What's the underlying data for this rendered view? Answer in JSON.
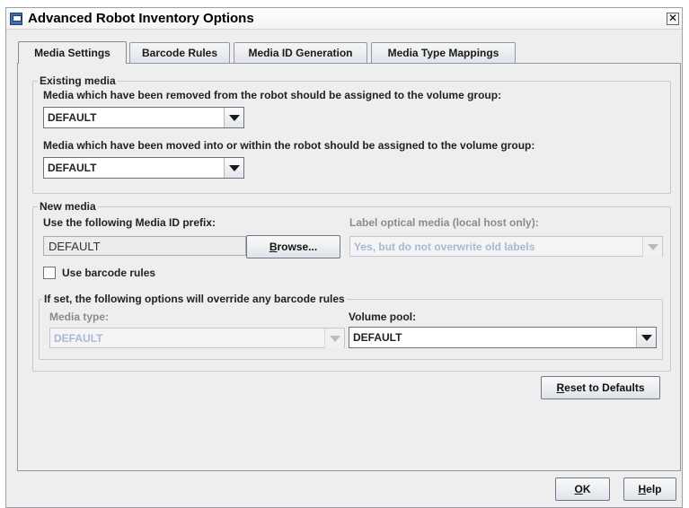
{
  "window": {
    "title": "Advanced Robot Inventory Options",
    "close_glyph": "✕"
  },
  "tabs": [
    {
      "label": "Media Settings",
      "active": true
    },
    {
      "label": "Barcode Rules",
      "active": false
    },
    {
      "label": "Media ID Generation",
      "active": false
    },
    {
      "label": "Media Type Mappings",
      "active": false
    }
  ],
  "existing_media": {
    "title": "Existing media",
    "removed_label": "Media which have been removed from the robot should be assigned to the volume group:",
    "removed_value": "DEFAULT",
    "moved_label": "Media which have been moved into or within the robot should be assigned to the volume group:",
    "moved_value": "DEFAULT"
  },
  "new_media": {
    "title": "New media",
    "prefix_label": "Use the following Media ID prefix:",
    "prefix_value": "DEFAULT",
    "browse_button": {
      "pre": "",
      "mnemonic": "B",
      "post": "rowse..."
    },
    "optical_label": "Label optical media (local host only):",
    "optical_value": "Yes, but do not overwrite old labels",
    "use_barcode_rules_label": "Use barcode rules",
    "use_barcode_rules_checked": false
  },
  "override": {
    "title": "If set, the following options will override any barcode rules",
    "media_type_label": "Media type:",
    "media_type_value": "DEFAULT",
    "volume_pool_label": "Volume pool:",
    "volume_pool_value": "DEFAULT"
  },
  "reset_button": {
    "pre": "",
    "mnemonic": "R",
    "post": "eset to Defaults"
  },
  "ok_button": {
    "pre": "",
    "mnemonic": "O",
    "post": "K"
  },
  "help_button": {
    "pre": "",
    "mnemonic": "H",
    "post": "elp"
  }
}
